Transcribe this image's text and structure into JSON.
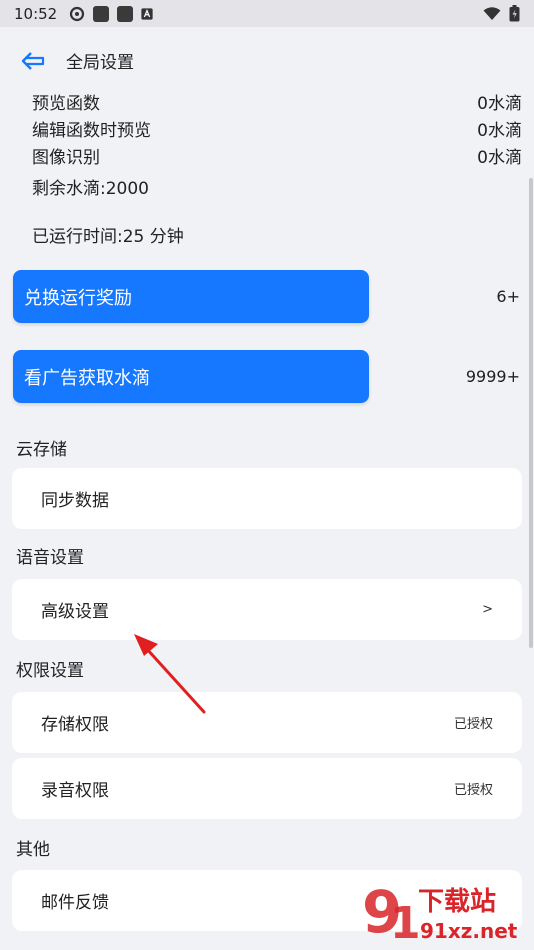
{
  "status": {
    "time": "10:52"
  },
  "header": {
    "title": "全局设置"
  },
  "usage": [
    {
      "label": "预览函数",
      "value": "0水滴"
    },
    {
      "label": "编辑函数时预览",
      "value": "0水滴"
    },
    {
      "label": "图像识别",
      "value": "0水滴"
    }
  ],
  "remaining": "剩余水滴:2000",
  "runtime": "已运行时间:25 分钟",
  "buttons": {
    "redeem": {
      "label": "兑换运行奖励",
      "count": "6+"
    },
    "ad": {
      "label": "看广告获取水滴",
      "count": "9999+"
    }
  },
  "sections": {
    "cloud": {
      "title": "云存储",
      "items": [
        "同步数据"
      ]
    },
    "voice": {
      "title": "语音设置",
      "items": [
        {
          "label": "高级设置",
          "right": ">"
        }
      ]
    },
    "permissions": {
      "title": "权限设置",
      "items": [
        {
          "label": "存储权限",
          "status": "已授权"
        },
        {
          "label": "录音权限",
          "status": "已授权"
        }
      ]
    },
    "other": {
      "title": "其他",
      "items": [
        "邮件反馈"
      ]
    }
  },
  "watermark": {
    "brand": "下载站",
    "domain": "91xz.net"
  },
  "colors": {
    "accent": "#1677ff",
    "arrow": "#e02020",
    "watermark": "#d9252a"
  }
}
